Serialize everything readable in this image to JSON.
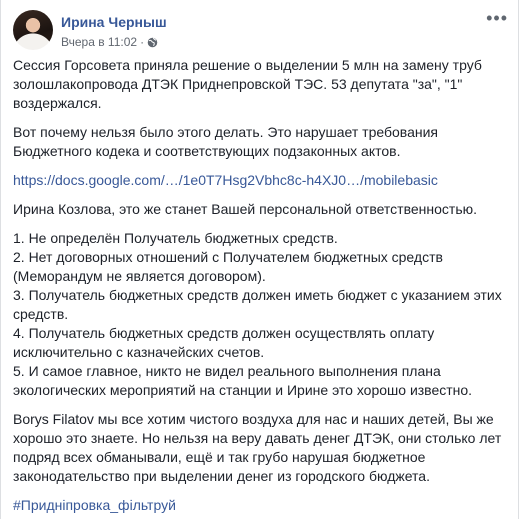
{
  "post": {
    "author": "Ирина Черныш",
    "time": "Вчера в 11:02",
    "separator": "·",
    "privacy_icon": "globe-icon",
    "more_icon": "more-options-icon",
    "paragraphs": {
      "p1": "Сессия Горсовета приняла решение о выделении 5 млн на замену труб золошлакопровода ДТЭК Приднепровской ТЭС. 53 депутата \"за\", \"1\" воздержался.",
      "p2": "Вот почему нельзя было этого делать. Это нарушает требования Бюджетного кодека и соответствующих подзаконных актов.",
      "link": "https://docs.google.com/…/1e0T7Hsg2Vbhc8c-h4XJ0…/mobilebasic",
      "p3": "Ирина Козлова, это же станет Вашей персональной ответственностью.",
      "list": [
        "1. Не определён Получатель бюджетных средств.",
        "2. Нет договорных отношений с Получателем бюджетных средств (Меморандум не является договором).",
        "3. Получатель бюджетных средств должен иметь бюджет с указанием этих средств.",
        "4. Получатель бюджетных средств должен осуществлять оплату исключительно с казначейских счетов.",
        "5. И самое главное, никто не видел реального выполнения плана экологических мероприятий на станции и Ирине это хорошо известно."
      ],
      "p4": "Borys Filatov мы все хотим чистого воздуха для нас и наших детей, Вы же хорошо это знаете. Но нельзя на веру давать денег ДТЭК, они столько лет подряд всех обманывали, ещё и так грубо нарушая бюджетное законодательство при выделении денег из городского бюджета.",
      "hashtag": "#Придніпровка_фільтруй"
    }
  },
  "colors": {
    "link": "#385898",
    "text": "#1d2129",
    "meta": "#616770"
  }
}
